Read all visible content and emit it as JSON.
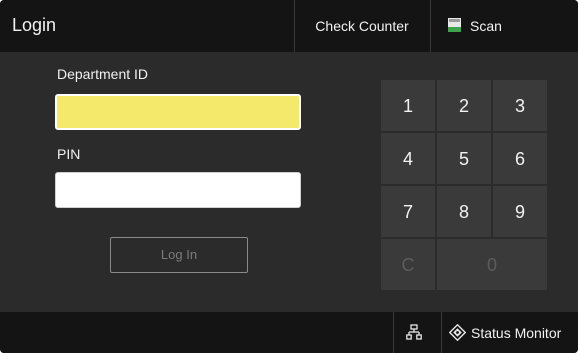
{
  "header": {
    "title": "Login",
    "check_counter_label": "Check Counter",
    "scan_label": "Scan",
    "scan_icon": "scan-document-icon"
  },
  "form": {
    "department_id_label": "Department ID",
    "department_id_value": "",
    "pin_label": "PIN",
    "pin_value": "",
    "login_button_label": "Log In"
  },
  "keypad": {
    "keys": [
      "1",
      "2",
      "3",
      "4",
      "5",
      "6",
      "7",
      "8",
      "9",
      "C",
      "0"
    ]
  },
  "footer": {
    "network_icon": "network-icon",
    "status_monitor_icon": "status-monitor-icon",
    "status_monitor_label": "Status Monitor"
  },
  "colors": {
    "background": "#2b2b2b",
    "bar": "#141414",
    "active_field": "#f4e96a",
    "key": "#3a3a3a",
    "scan_icon_green": "#3fa34d"
  }
}
